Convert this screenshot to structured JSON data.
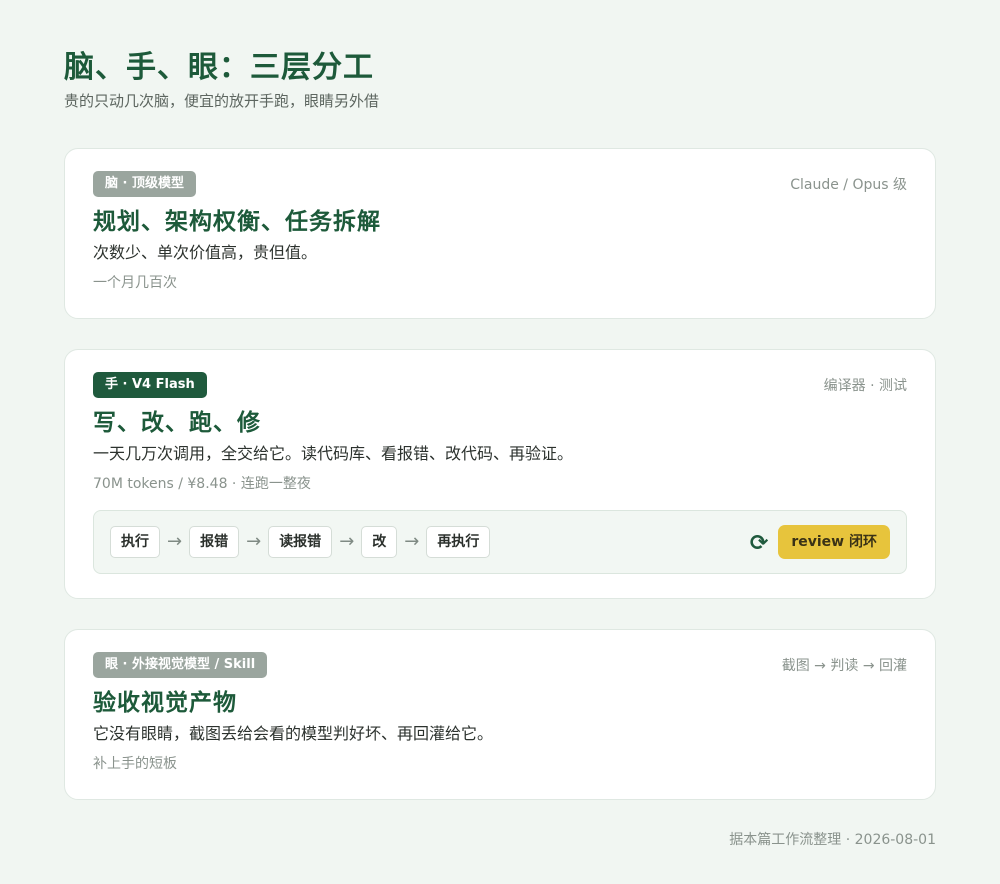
{
  "header": {
    "title": "脑、手、眼：三层分工",
    "subtitle": "贵的只动几次脑，便宜的放开手跑，眼睛另外借"
  },
  "cards": [
    {
      "badge": "脑 · 顶级模型",
      "meta": "Claude / Opus 级",
      "heading": "规划、架构权衡、任务拆解",
      "desc": "次数少、单次价值高，贵但值。",
      "note": "一个月几百次"
    },
    {
      "badge": "手 · V4 Flash",
      "meta": "编译器 · 测试",
      "heading": "写、改、跑、修",
      "desc": "一天几万次调用，全交给它。读代码库、看报错、改代码、再验证。",
      "note": "70M tokens / ¥8.48 · 连跑一整夜",
      "flow": {
        "steps": [
          "执行",
          "报错",
          "读报错",
          "改",
          "再执行"
        ],
        "arrow": "→",
        "loop_icon": "⟳",
        "review_label": "review 闭环"
      }
    },
    {
      "badge": "眼 · 外接视觉模型 / Skill",
      "meta": "截图 → 判读 → 回灌",
      "heading": "验收视觉产物",
      "desc": "它没有眼睛，截图丢给会看的模型判好坏、再回灌给它。",
      "note": "补上手的短板"
    }
  ],
  "footer": "据本篇工作流整理 · 2026-08-01",
  "colors": {
    "background": "#f1f6f2",
    "accent": "#1d5a3a",
    "badge_primary": "#1f5a3d",
    "badge_muted": "#9aa59e",
    "review": "#e7c43c"
  }
}
